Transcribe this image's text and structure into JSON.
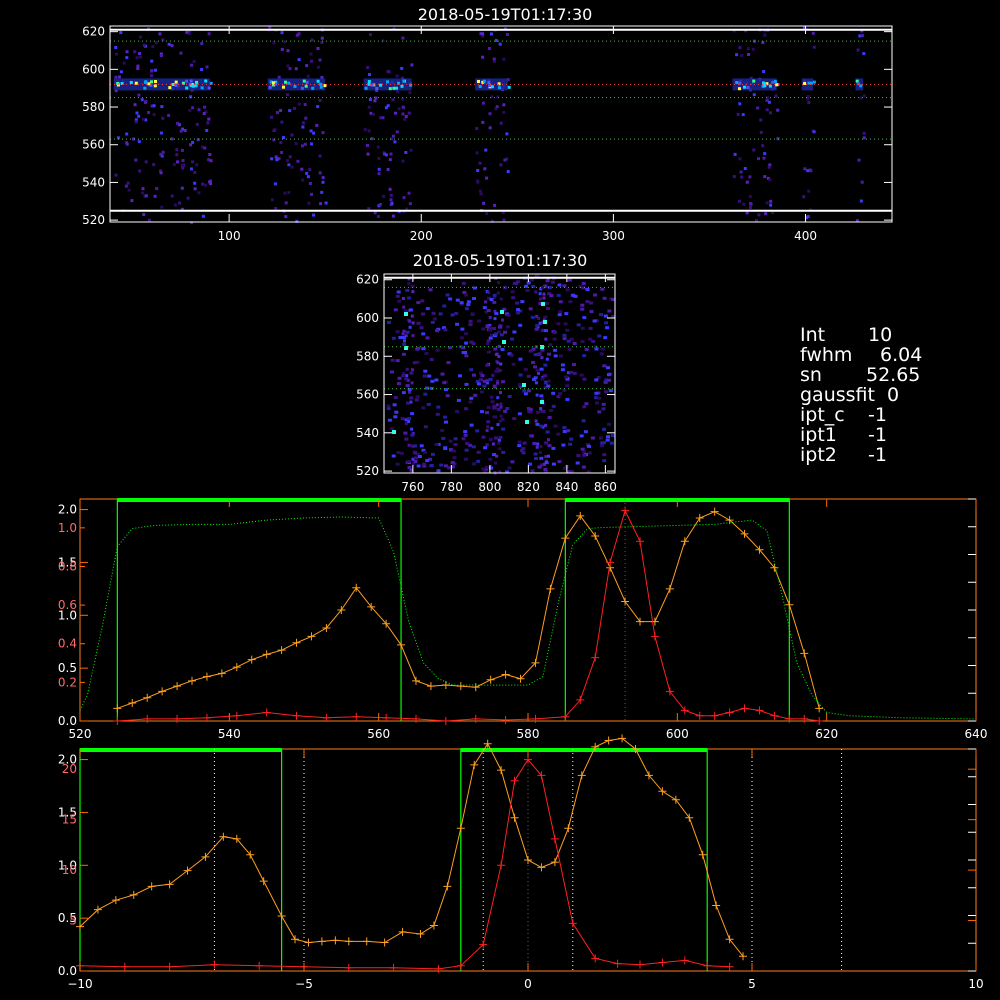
{
  "panels": {
    "top": {
      "title": "2018-05-19T01:17:30",
      "x_ticks": [
        "100",
        "200",
        "300",
        "400"
      ],
      "y_ticks": [
        "520",
        "540",
        "560",
        "580",
        "600",
        "620"
      ]
    },
    "mid": {
      "title": "2018-05-19T01:17:30",
      "x_ticks": [
        "760",
        "780",
        "800",
        "820",
        "840",
        "860"
      ],
      "y_ticks": [
        "520",
        "540",
        "560",
        "580",
        "600",
        "620"
      ]
    }
  },
  "info": [
    {
      "label": "Int",
      "value": "10"
    },
    {
      "label": "fwhm",
      "value": "6.04"
    },
    {
      "label": "sn",
      "value": "52.65"
    },
    {
      "label": "gaussfit",
      "value": "0"
    },
    {
      "label": "ipt_c",
      "value": "-1"
    },
    {
      "label": "ipt1",
      "value": "-1"
    },
    {
      "label": "ipt2",
      "value": "-1"
    }
  ],
  "colors": {
    "axis": "#ffffff",
    "spectrum": "#ff2020",
    "profile": "#ffa020",
    "filter": "#00ff00",
    "highlight": "#00ff00",
    "accent_axis": "#ff6a00"
  },
  "chart_data": [
    {
      "type": "heatmap",
      "title": "2018-05-19T01:17:30",
      "xlim": [
        38,
        445
      ],
      "ylim": [
        519,
        623
      ],
      "x_ticks": [
        100,
        200,
        300,
        400
      ],
      "y_ticks": [
        520,
        540,
        560,
        580,
        600,
        620
      ],
      "bright_x_ranges": [
        [
          40,
          90
        ],
        [
          120,
          150
        ],
        [
          170,
          195
        ],
        [
          228,
          245
        ],
        [
          362,
          385
        ],
        [
          398,
          404
        ],
        [
          426,
          430
        ]
      ],
      "line_center_y": 592,
      "guide_lines_y": [
        525,
        563,
        585,
        592,
        615,
        621
      ]
    },
    {
      "type": "heatmap",
      "title": "2018-05-19T01:17:30",
      "xlim": [
        745,
        865
      ],
      "ylim": [
        519,
        623
      ],
      "x_ticks": [
        760,
        780,
        800,
        820,
        840,
        860
      ],
      "y_ticks": [
        520,
        540,
        560,
        580,
        600,
        620
      ],
      "bright_x_ranges": [
        [
          754,
          760
        ],
        [
          797,
          806
        ],
        [
          823,
          830
        ]
      ],
      "guide_lines_y": [
        563,
        585,
        616,
        621
      ]
    },
    {
      "type": "line",
      "xlim": [
        520,
        640
      ],
      "x_ticks": [
        520,
        540,
        560,
        580,
        600,
        620,
        640
      ],
      "left_axis_ticks": [
        0.0,
        0.5,
        1.0,
        1.5,
        2.0
      ],
      "left_axis2_ticks": [
        0.2,
        0.4,
        0.6,
        0.8,
        1.0
      ],
      "left_axis_labels": [
        "0.0",
        "0.5",
        "1.0",
        "1.5",
        "2.0",
        "0.2",
        "0.4",
        "0.6",
        "0.8",
        "1.0"
      ],
      "x_tick_labels": [
        "520",
        "540",
        "560",
        "580",
        "600",
        "620",
        "640"
      ],
      "ylim": [
        0,
        2.1
      ],
      "filter_windows": [
        [
          525,
          563
        ],
        [
          585,
          615
        ]
      ],
      "vertical_marker": 593,
      "series": [
        {
          "name": "",
          "color": "#ffa020",
          "style": "plus",
          "x": [
            525,
            527,
            529,
            531,
            533,
            535,
            537,
            539,
            541,
            543,
            545,
            547,
            549,
            551,
            553,
            555,
            557,
            559,
            561,
            563,
            565,
            567,
            569,
            571,
            573,
            575,
            577,
            579,
            581,
            583,
            585,
            587,
            589,
            591,
            593,
            595,
            597,
            599,
            601,
            603,
            605,
            607,
            609,
            611,
            613,
            615,
            617,
            619
          ],
          "y": [
            0.12,
            0.17,
            0.22,
            0.28,
            0.33,
            0.38,
            0.42,
            0.45,
            0.51,
            0.58,
            0.63,
            0.67,
            0.74,
            0.8,
            0.88,
            1.05,
            1.26,
            1.08,
            0.92,
            0.72,
            0.38,
            0.33,
            0.34,
            0.33,
            0.32,
            0.39,
            0.44,
            0.4,
            0.55,
            1.25,
            1.73,
            1.94,
            1.75,
            1.45,
            1.13,
            0.94,
            0.94,
            1.25,
            1.7,
            1.92,
            1.98,
            1.9,
            1.77,
            1.62,
            1.45,
            1.1,
            0.64,
            0.12
          ]
        },
        {
          "name": "",
          "color": "#ff2020",
          "style": "plus",
          "x": [
            525,
            529,
            533,
            537,
            541,
            545,
            549,
            553,
            557,
            561,
            565,
            569,
            573,
            577,
            581,
            585,
            587,
            589,
            591,
            593,
            595,
            597,
            599,
            601,
            603,
            605,
            607,
            609,
            611,
            613,
            615,
            617,
            619
          ],
          "y": [
            0.0,
            0.02,
            0.02,
            0.03,
            0.05,
            0.08,
            0.05,
            0.03,
            0.04,
            0.03,
            0.02,
            0.0,
            0.02,
            0.01,
            0.02,
            0.04,
            0.2,
            0.6,
            1.5,
            1.99,
            1.7,
            0.8,
            0.28,
            0.1,
            0.05,
            0.05,
            0.08,
            0.12,
            0.1,
            0.05,
            0.02,
            0.02,
            0.0
          ]
        },
        {
          "name": "",
          "color": "#00ff00",
          "style": "dotted",
          "x": [
            520,
            521,
            523,
            525,
            527,
            530,
            535,
            540,
            545,
            550,
            555,
            560,
            562,
            564,
            566,
            568,
            570,
            575,
            580,
            582,
            584,
            586,
            588,
            590,
            595,
            600,
            605,
            610,
            612,
            614,
            616,
            618,
            620,
            623,
            630,
            640
          ],
          "y": [
            0.1,
            0.25,
            0.9,
            1.65,
            1.82,
            1.85,
            1.86,
            1.86,
            1.9,
            1.92,
            1.93,
            1.92,
            1.6,
            0.95,
            0.55,
            0.4,
            0.34,
            0.34,
            0.34,
            0.42,
            1.1,
            1.67,
            1.82,
            1.83,
            1.84,
            1.85,
            1.86,
            1.9,
            1.8,
            1.2,
            0.55,
            0.25,
            0.08,
            0.05,
            0.03,
            0.02
          ]
        }
      ]
    },
    {
      "type": "line",
      "xlim": [
        -10,
        10
      ],
      "x_ticks": [
        -10,
        -5,
        0,
        5,
        10
      ],
      "x_tick_labels": [
        "−10",
        "−5",
        "0",
        "5",
        "10"
      ],
      "left_axis_ticks": [
        0.0,
        0.5,
        1.0,
        1.5,
        2.0
      ],
      "left_axis_labels": [
        "0.0",
        "0.5",
        "1.0",
        "1.5",
        "2.0"
      ],
      "right_axis_ticks": [
        5,
        10,
        15,
        20
      ],
      "right_axis_labels": [
        "5",
        "10",
        "15",
        "20"
      ],
      "ylim": [
        0,
        2.1
      ],
      "filter_windows": [
        [
          -10,
          -5.5
        ],
        [
          -1.5,
          4
        ]
      ],
      "vertical_markers": [
        -7,
        -5,
        -1,
        1,
        5,
        7
      ],
      "center_marker": 0,
      "series": [
        {
          "name": "",
          "color": "#ffa020",
          "style": "plus",
          "x": [
            -10,
            -9.6,
            -9.2,
            -8.8,
            -8.4,
            -8.0,
            -7.6,
            -7.2,
            -6.8,
            -6.5,
            -6.2,
            -5.9,
            -5.5,
            -5.2,
            -4.9,
            -4.6,
            -4.3,
            -4.0,
            -3.6,
            -3.2,
            -2.8,
            -2.4,
            -2.1,
            -1.8,
            -1.5,
            -1.2,
            -0.9,
            -0.6,
            -0.3,
            0.0,
            0.3,
            0.6,
            0.9,
            1.2,
            1.5,
            1.8,
            2.1,
            2.4,
            2.7,
            3.0,
            3.3,
            3.6,
            3.9,
            4.2,
            4.5,
            4.8
          ],
          "y": [
            0.42,
            0.58,
            0.67,
            0.72,
            0.8,
            0.82,
            0.95,
            1.08,
            1.27,
            1.25,
            1.1,
            0.85,
            0.52,
            0.3,
            0.27,
            0.28,
            0.29,
            0.28,
            0.28,
            0.27,
            0.37,
            0.35,
            0.43,
            0.8,
            1.35,
            1.95,
            2.15,
            1.9,
            1.45,
            1.05,
            0.98,
            1.03,
            1.35,
            1.85,
            2.12,
            2.18,
            2.2,
            2.1,
            1.85,
            1.7,
            1.62,
            1.45,
            1.1,
            0.62,
            0.3,
            0.14
          ]
        },
        {
          "name": "",
          "color": "#ff2020",
          "style": "plus",
          "x": [
            -10,
            -9,
            -8,
            -7,
            -6,
            -5,
            -4,
            -3,
            -2,
            -1.5,
            -1,
            -0.6,
            -0.3,
            0,
            0.3,
            0.6,
            1,
            1.5,
            2,
            2.5,
            3,
            3.5,
            4,
            4.5
          ],
          "y": [
            0.05,
            0.04,
            0.04,
            0.06,
            0.05,
            0.04,
            0.03,
            0.03,
            0.02,
            0.05,
            0.25,
            1.0,
            1.8,
            2.0,
            1.85,
            1.25,
            0.45,
            0.12,
            0.07,
            0.06,
            0.08,
            0.1,
            0.05,
            0.04
          ]
        }
      ]
    }
  ]
}
